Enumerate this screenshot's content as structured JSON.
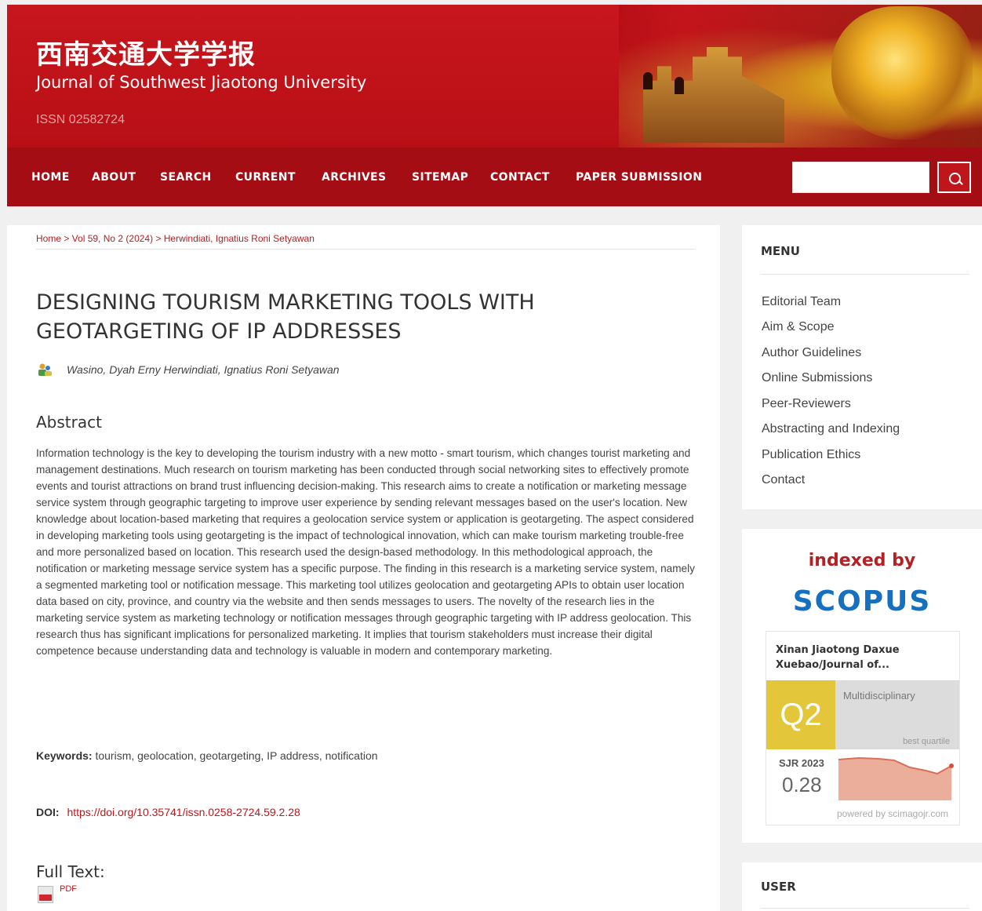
{
  "header": {
    "title_cn": "西南交通大学学报",
    "title_en": "Journal of Southwest Jiaotong University",
    "issn": "ISSN 02582724"
  },
  "nav": {
    "items": [
      "HOME",
      "ABOUT",
      "SEARCH",
      "CURRENT",
      "ARCHIVES",
      "SITEMAP",
      "CONTACT",
      "PAPER SUBMISSION"
    ],
    "search_placeholder": "",
    "search_icon": "search-icon"
  },
  "breadcrumb": "Home > Vol 59, No 2 (2024) > Herwindiati, Ignatius Roni Setyawan",
  "article": {
    "title": "DESIGNING TOURISM MARKETING TOOLS WITH GEOTARGETING OF IP ADDRESSES",
    "authors": "Wasino, Dyah Erny Herwindiati, Ignatius Roni Setyawan",
    "abstract_heading": "Abstract",
    "abstract": "Information technology is the key to developing the tourism industry with a new motto - smart tourism, which changes tourist marketing and management destinations. Much research on tourism marketing has been conducted through social networking sites to effectively promote events and tourist attractions on brand trust influencing decision-making. This research aims to create a notification or marketing message service system through geographic targeting to improve user experience by sending relevant messages based on the user's location. New knowledge about location-based marketing that requires a geolocation service system or application is geotargeting. The aspect considered in developing marketing tools using geotargeting is the impact of technological innovation, which can make tourism marketing trouble-free and more personalized based on location. This research used the design-based methodology. In this methodological approach, the notification or marketing message service system has a specific purpose. The finding in this research is a marketing service system, namely a segmented marketing tool or notification message. This marketing tool utilizes geolocation and geotargeting APIs to obtain user location data based on city, province, and country via the website and then sends messages to users. The novelty of the research lies in the marketing service system as marketing technology or notification messages through geographic targeting with IP address geolocation. This research thus has significant implications for personalized marketing. It implies that tourism stakeholders must increase their digital competence because understanding data and technology is valuable in modern and contemporary marketing.",
    "keywords_label": "Keywords:",
    "keywords": "tourism, geolocation, geotargeting, IP address, notification",
    "doi_label": "DOI:",
    "doi": "https://doi.org/10.35741/issn.0258-2724.59.2.28",
    "fulltext_heading": "Full Text:",
    "pdf_label": "PDF"
  },
  "sidebar": {
    "menu_title": "MENU",
    "menu_items": [
      "Editorial Team",
      "Aim & Scope",
      "Author Guidelines",
      "Online Submissions",
      "Peer-Reviewers",
      "Abstracting and Indexing",
      "Publication Ethics",
      "Contact"
    ],
    "indexed_by": "indexed by",
    "scopus": "SCOPUS",
    "sjr": {
      "journal_name": "Xinan Jiaotong Daxue Xuebao/Journal of...",
      "quartile": "Q2",
      "category": "Multidisciplinary",
      "best_quartile": "best quartile",
      "year_label": "SJR 2023",
      "value": "0.28",
      "powered_by": "powered by scimagojr.com"
    },
    "user_title": "USER"
  },
  "colors": {
    "brand_red": "#c1151c",
    "nav_red": "#a30d13",
    "scopus_blue": "#1570c0",
    "quartile_yellow": "#e4c63a"
  }
}
